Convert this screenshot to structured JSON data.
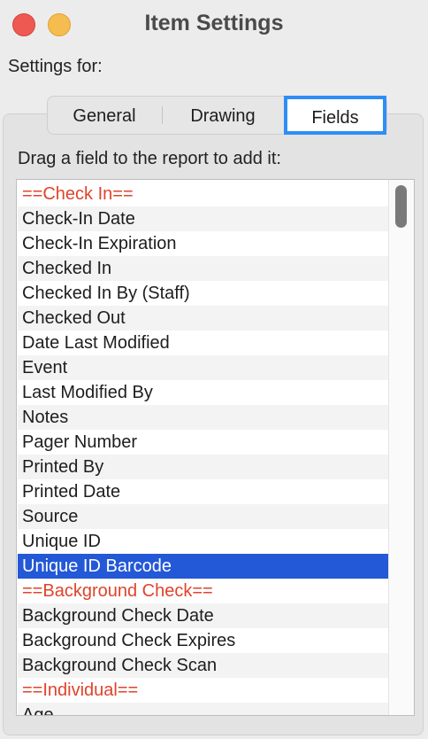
{
  "window": {
    "title": "Item Settings"
  },
  "settings_for_label": "Settings for:",
  "tabs": [
    {
      "label": "General"
    },
    {
      "label": "Drawing"
    },
    {
      "label": "Fields"
    }
  ],
  "selected_tab": "Fields",
  "instruction": "Drag a field to the report to add it:",
  "fields": [
    {
      "label": "==Check In==",
      "type": "header"
    },
    {
      "label": "Check-In Date"
    },
    {
      "label": "Check-In Expiration"
    },
    {
      "label": "Checked In"
    },
    {
      "label": "Checked In By (Staff)"
    },
    {
      "label": "Checked Out"
    },
    {
      "label": "Date Last Modified"
    },
    {
      "label": "Event"
    },
    {
      "label": "Last Modified By"
    },
    {
      "label": "Notes"
    },
    {
      "label": "Pager Number"
    },
    {
      "label": "Printed By"
    },
    {
      "label": "Printed Date"
    },
    {
      "label": "Source"
    },
    {
      "label": "Unique ID"
    },
    {
      "label": "Unique ID Barcode",
      "selected": true
    },
    {
      "label": "==Background Check==",
      "type": "header"
    },
    {
      "label": "Background Check Date"
    },
    {
      "label": "Background Check Expires"
    },
    {
      "label": "Background Check Scan"
    },
    {
      "label": "==Individual==",
      "type": "header"
    },
    {
      "label": "Age"
    }
  ],
  "colors": {
    "header_text": "#e0432b",
    "selection": "#2358d6",
    "tab_focus_ring": "#2f8ef4",
    "close_button": "#ee5a52",
    "minimize_button": "#f5bd4f"
  },
  "icons": {
    "close": "close-window-button",
    "minimize": "minimize-window-button"
  }
}
